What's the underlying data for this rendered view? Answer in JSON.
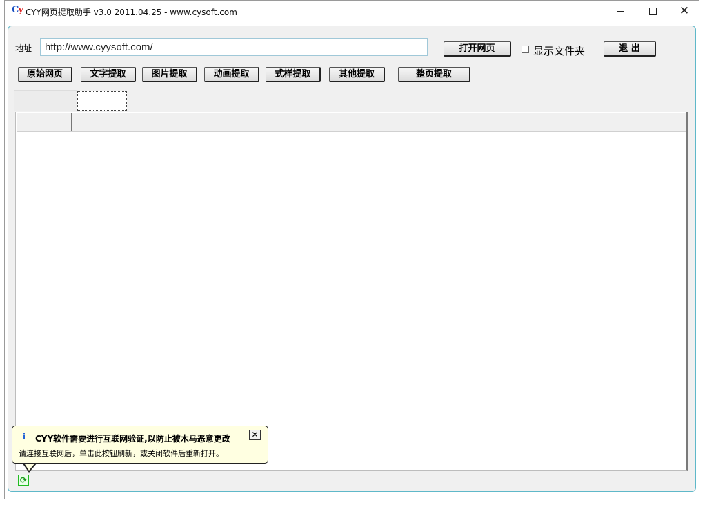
{
  "window": {
    "icon_text_c": "C",
    "icon_text_y": "y",
    "title": "CYY网页提取助手 v3.0 2011.04.25 - www.cysoft.com",
    "close_glyph": "✕"
  },
  "address": {
    "label": "地址",
    "url": "http://www.cyysoft.com/"
  },
  "toolbar": {
    "open_button": "打开网页",
    "show_folder_label": "显示文件夹",
    "show_folder_checked": false,
    "exit_button": "退  出"
  },
  "extract_buttons": [
    "原始网页",
    "文字提取",
    "图片提取",
    "动画提取",
    "式样提取",
    "其他提取",
    "整页提取"
  ],
  "balloon": {
    "info_icon": "i",
    "title": "CYY软件需要进行互联网验证,以防止被木马恶意更改",
    "message": "请连接互联网后，单击此按钮刷新，或关闭软件后重新打开。",
    "close_glyph": "✕"
  },
  "status": {
    "refresh_icon": "refresh-icon"
  }
}
